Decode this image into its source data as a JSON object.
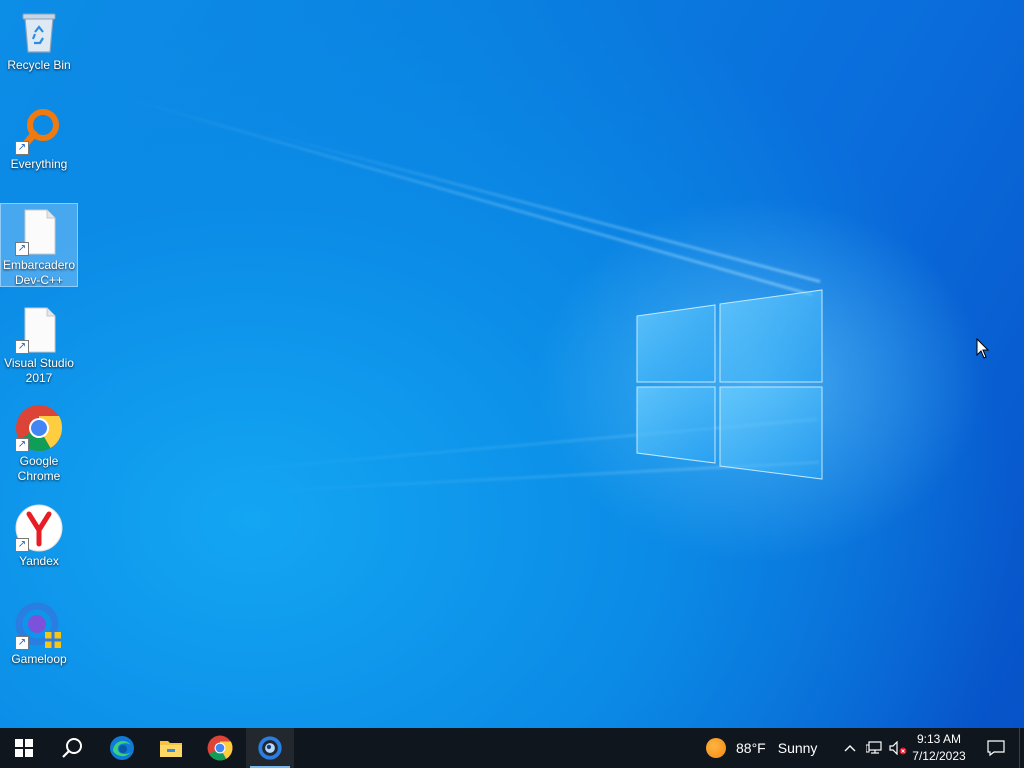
{
  "desktop": {
    "icons": [
      {
        "label": "Recycle Bin",
        "icon": "recycle-bin-icon",
        "shortcut": false,
        "selected": false
      },
      {
        "label": "Everything",
        "icon": "everything-search-icon",
        "shortcut": true,
        "selected": false
      },
      {
        "label": "Embarcadero Dev-C++",
        "icon": "blank-document-icon",
        "shortcut": true,
        "selected": true
      },
      {
        "label": "Visual Studio 2017",
        "icon": "blank-document-icon",
        "shortcut": true,
        "selected": false
      },
      {
        "label": "Google Chrome",
        "icon": "chrome-icon",
        "shortcut": true,
        "selected": false
      },
      {
        "label": "Yandex",
        "icon": "yandex-icon",
        "shortcut": true,
        "selected": false
      },
      {
        "label": "Gameloop",
        "icon": "gameloop-icon",
        "shortcut": true,
        "selected": false
      }
    ]
  },
  "taskbar": {
    "pinned": [
      {
        "name": "start-button",
        "icon": "windows-icon"
      },
      {
        "name": "search-button",
        "icon": "search-icon"
      },
      {
        "name": "edge-button",
        "icon": "edge-icon"
      },
      {
        "name": "file-explorer-button",
        "icon": "folder-icon"
      },
      {
        "name": "chrome-taskbar-button",
        "icon": "chrome-icon"
      },
      {
        "name": "gameloop-taskbar-button",
        "icon": "gameloop-icon",
        "active": true
      }
    ],
    "weather": {
      "temp": "88°F",
      "condition": "Sunny"
    },
    "clock": {
      "time": "9:13 AM",
      "date": "7/12/2023"
    },
    "accent_color": "#76b9ed"
  }
}
